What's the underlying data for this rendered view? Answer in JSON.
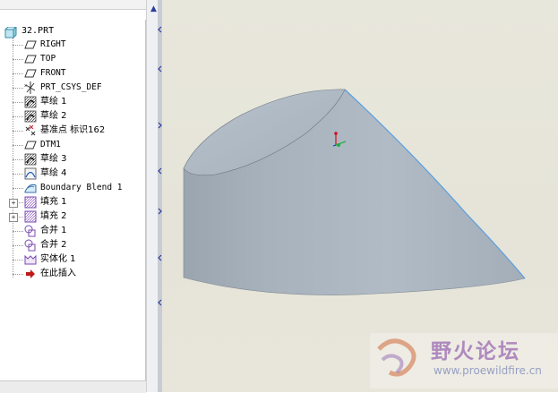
{
  "model_tree": {
    "root": "32.PRT",
    "items": [
      {
        "label": "RIGHT",
        "icon": "datum-plane-icon"
      },
      {
        "label": "TOP",
        "icon": "datum-plane-icon"
      },
      {
        "label": "FRONT",
        "icon": "datum-plane-icon"
      },
      {
        "label": "PRT_CSYS_DEF",
        "icon": "csys-icon"
      },
      {
        "label": "草绘 1",
        "icon": "sketch-icon"
      },
      {
        "label": "草绘 2",
        "icon": "sketch-icon"
      },
      {
        "label": "基准点 标识162",
        "icon": "datum-point-icon"
      },
      {
        "label": "DTM1",
        "icon": "datum-plane-icon"
      },
      {
        "label": "草绘 3",
        "icon": "sketch-icon"
      },
      {
        "label": "草绘 4",
        "icon": "sketch-icon"
      },
      {
        "label": "Boundary Blend 1",
        "icon": "boundary-blend-icon"
      },
      {
        "label": "填充 1",
        "icon": "fill-icon",
        "expandable": true
      },
      {
        "label": "填充 2",
        "icon": "fill-icon",
        "expandable": true
      },
      {
        "label": "合并 1",
        "icon": "merge-icon"
      },
      {
        "label": "合并 2",
        "icon": "merge-icon"
      },
      {
        "label": "实体化 1",
        "icon": "solidify-icon"
      },
      {
        "label": "在此插入",
        "icon": "insert-here-arrow-icon"
      }
    ]
  },
  "watermark": {
    "title": "野火论坛",
    "url": "www.proewildfire.cn"
  },
  "colors": {
    "viewport_bg": "#e8e7dc",
    "model_body": "#a9b3bd",
    "model_edge": "#5aa0e0",
    "sash_arrow": "#2a3d9a"
  }
}
